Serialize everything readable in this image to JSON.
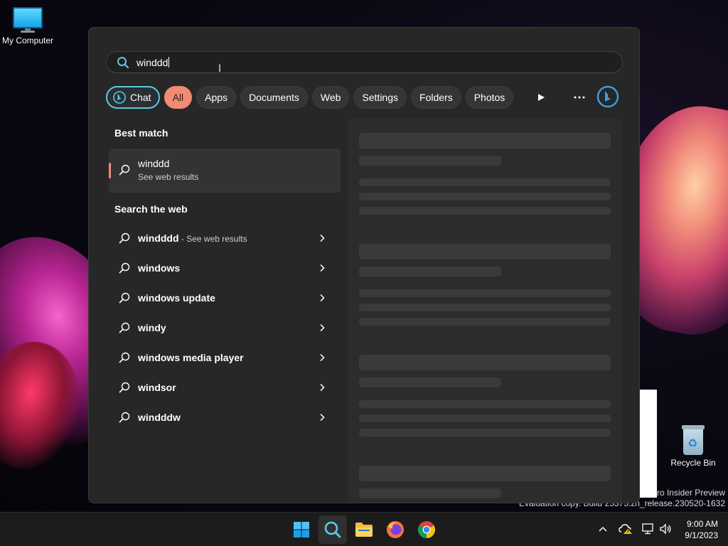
{
  "desktop": {
    "icons": [
      {
        "label": "My Computer"
      },
      {
        "label": "Recycle Bin"
      }
    ],
    "watermark": {
      "line1": "ro Insider Preview",
      "line2": "Evaluation copy. Build 25375.zn_release.230520-1632"
    }
  },
  "search": {
    "query": "winddd",
    "filters": [
      {
        "label": "Chat"
      },
      {
        "label": "All"
      },
      {
        "label": "Apps"
      },
      {
        "label": "Documents"
      },
      {
        "label": "Web"
      },
      {
        "label": "Settings"
      },
      {
        "label": "Folders"
      },
      {
        "label": "Photos"
      }
    ],
    "active_filter": "All",
    "best_match": {
      "heading": "Best match",
      "title": "winddd",
      "subtitle": "See web results"
    },
    "web": {
      "heading": "Search the web",
      "items": [
        {
          "label": "windddd",
          "suffix": " - See web results"
        },
        {
          "label": "windows"
        },
        {
          "label": "windows update"
        },
        {
          "label": "windy"
        },
        {
          "label": "windows media player"
        },
        {
          "label": "windsor"
        },
        {
          "label": "windddw"
        }
      ]
    }
  },
  "taskbar": {
    "apps": [
      "windows-start",
      "search",
      "file-explorer",
      "firefox",
      "chrome"
    ],
    "clock": {
      "time": "9:00 AM",
      "date": "9/1/2023"
    }
  },
  "colors": {
    "accent": "#f28b73",
    "chat_border": "#5cc8e6",
    "panel": "#272727",
    "taskbar": "#1c1c1c"
  }
}
